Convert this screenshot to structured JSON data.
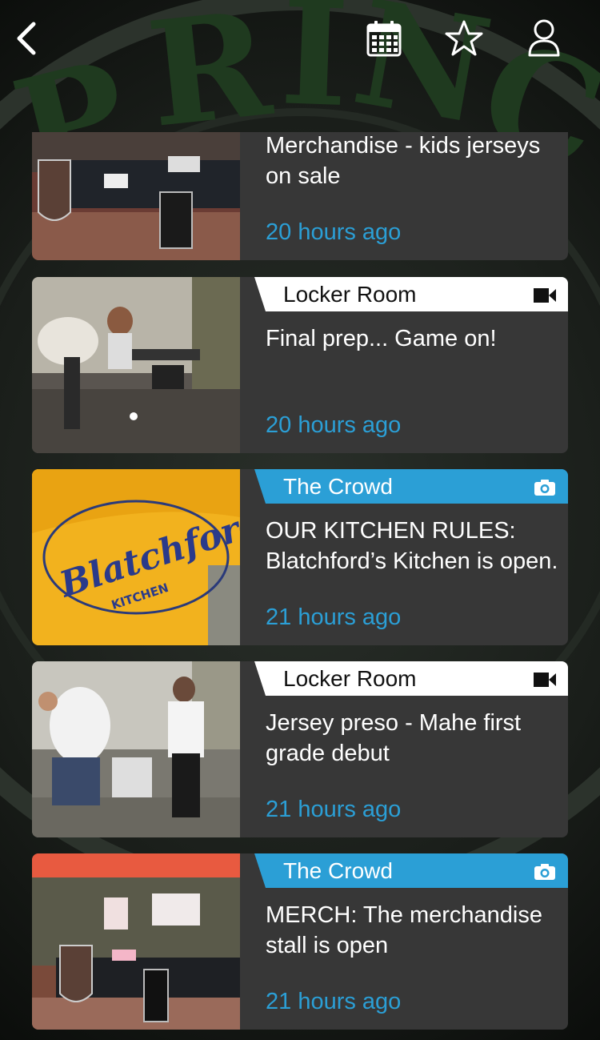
{
  "header": {
    "back_icon": "chevron-left-icon",
    "calendar_icon": "calendar-icon",
    "favorites_icon": "star-icon",
    "profile_icon": "user-icon"
  },
  "colors": {
    "card_bg": "#373737",
    "accent_blue": "#2b9fd6",
    "tag_white": "#ffffff"
  },
  "feed": [
    {
      "category": "",
      "media_icon": "",
      "title": "Merchandise - kids jerseys on sale",
      "time": "20 hours ago"
    },
    {
      "category": "Locker Room",
      "media_icon": "video-icon",
      "title": "Final prep... Game on!",
      "time": "20 hours ago"
    },
    {
      "category": "The Crowd",
      "media_icon": "camera-icon",
      "title": "OUR KITCHEN RULES: Blatchford’s Kitchen is open.",
      "time": "21 hours ago"
    },
    {
      "category": "Locker Room",
      "media_icon": "video-icon",
      "title": "Jersey preso - Mahe first grade debut",
      "time": "21 hours ago"
    },
    {
      "category": "The Crowd",
      "media_icon": "camera-icon",
      "title": "MERCH: The merchandise stall is open",
      "time": "21 hours ago"
    }
  ]
}
